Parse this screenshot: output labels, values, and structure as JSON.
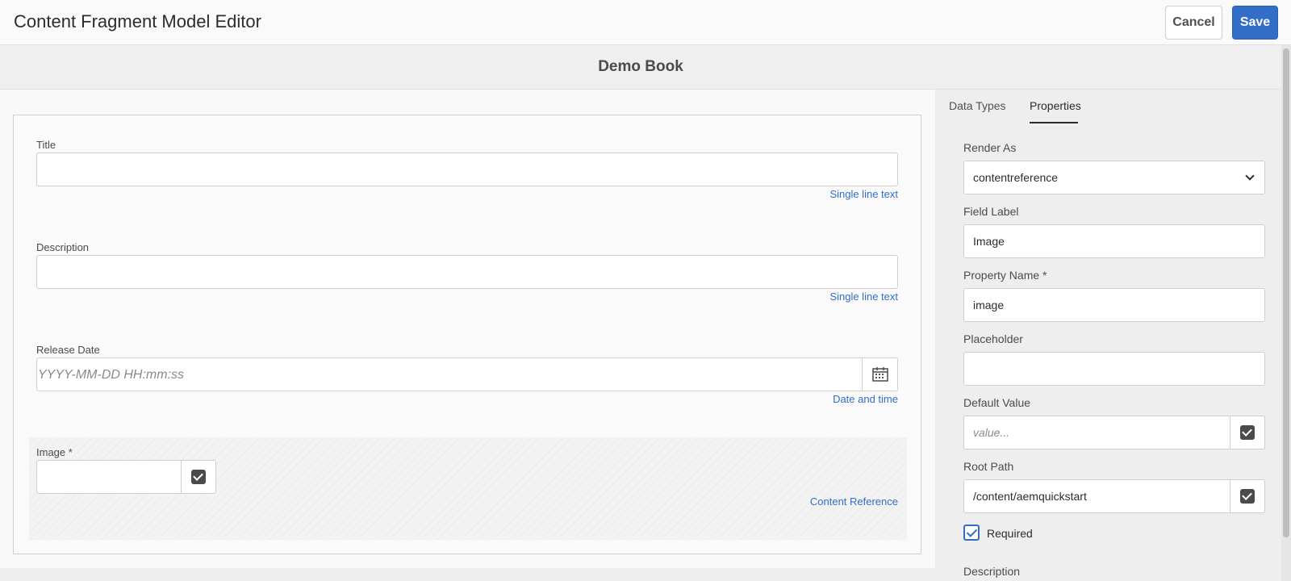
{
  "header": {
    "title": "Content Fragment Model Editor",
    "cancel_label": "Cancel",
    "save_label": "Save"
  },
  "model": {
    "title": "Demo Book"
  },
  "fields": [
    {
      "label": "Title",
      "type": "Single line text"
    },
    {
      "label": "Description",
      "type": "Single line text"
    },
    {
      "label": "Release Date",
      "type": "Date and time",
      "placeholder": "YYYY-MM-DD HH:mm:ss"
    },
    {
      "label": "Image *",
      "type": "Content Reference"
    }
  ],
  "panel": {
    "tabs": [
      {
        "label": "Data Types",
        "active": false
      },
      {
        "label": "Properties",
        "active": true
      }
    ],
    "render_as": {
      "label": "Render As",
      "value": "contentreference"
    },
    "field_label": {
      "label": "Field Label",
      "value": "Image"
    },
    "property_name": {
      "label": "Property Name *",
      "value": "image"
    },
    "placeholder": {
      "label": "Placeholder",
      "value": ""
    },
    "default_value": {
      "label": "Default Value",
      "placeholder": "value..."
    },
    "root_path": {
      "label": "Root Path",
      "value": "/content/aemquickstart"
    },
    "required": {
      "label": "Required",
      "checked": true
    },
    "description": {
      "label": "Description"
    }
  },
  "colors": {
    "accent": "#326ec8",
    "panel_bg": "#eeeeee",
    "link": "#326ec8"
  },
  "icons": {
    "calendar": "calendar-icon",
    "check": "checkbox-icon",
    "chevron": "chevron-down-icon"
  }
}
